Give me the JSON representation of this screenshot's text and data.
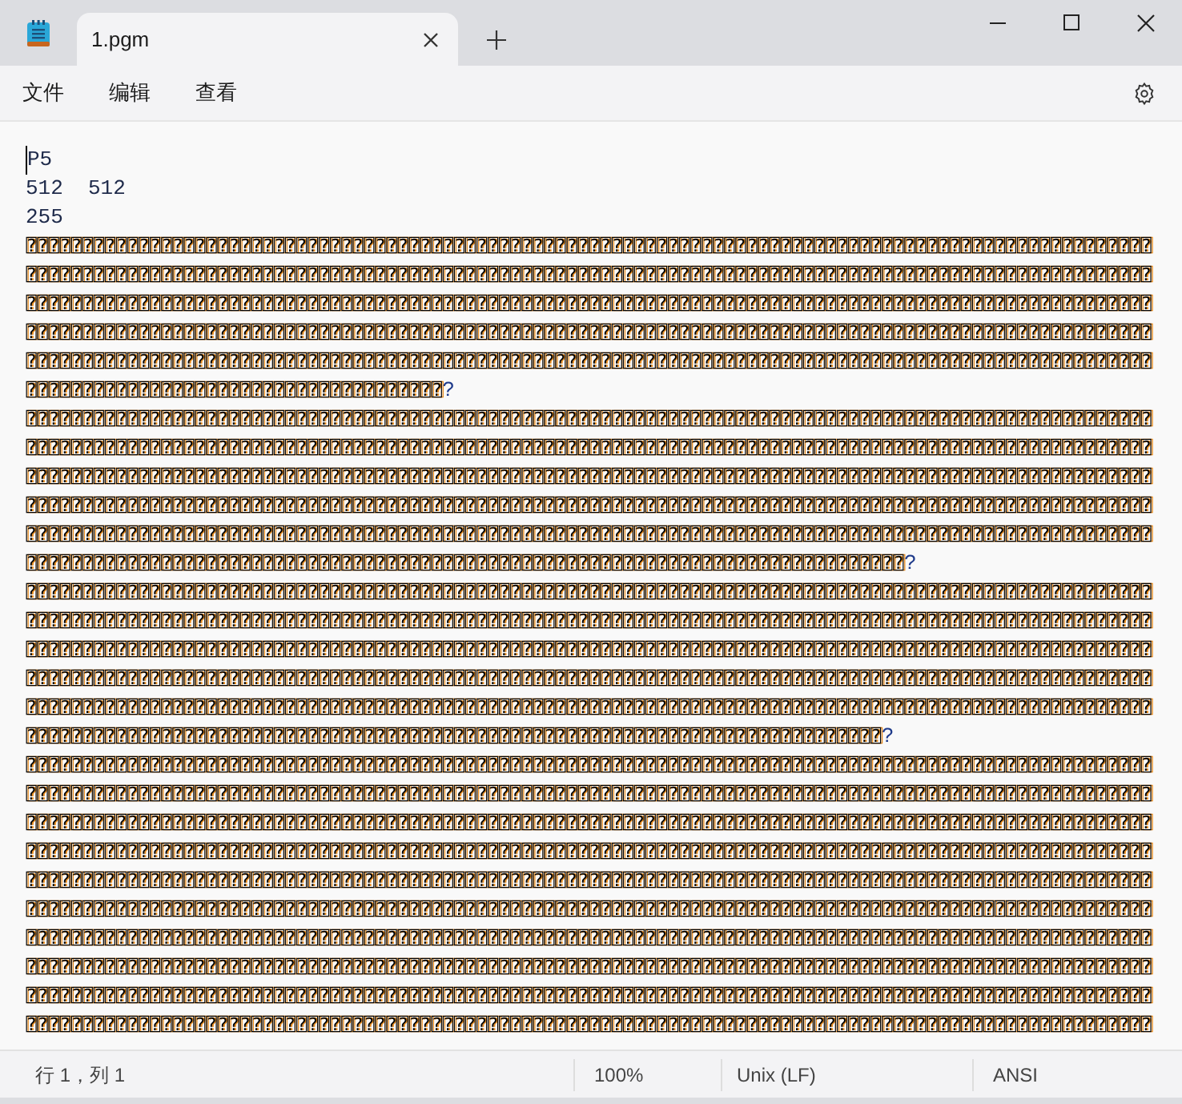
{
  "tabs": [
    {
      "label": "1.pgm",
      "selected": true
    }
  ],
  "menu": [
    "文件",
    "编辑",
    "查看"
  ],
  "editor": {
    "header_lines": [
      "P5",
      "512  512",
      "255"
    ],
    "binary_lines": [
      {
        "rows": [
          "⍰⍰⍰⍰⍰⍰⍰⍰⍰⍰⍰⍰⍰⍰⍰⍰⍰⍰⍰⍰⍰⍰⍰⍰⍰⍰⍰⍰⍰⍰⍰⍰⍰⍰⍰⍰⍰⍰⍰⍰⍰⍰⍰⍰⍰⍰⍰⍰⍰⍰⍰⍰⍰⍰⍰⍰⍰⍰⍰⍰⍰⍰⍰⍰⍰⍰⍰⍰⍰⍰⍰⍰⍰⍰⍰⍰⍰⍰⍰⍰⍰⍰⍰⍰⍰⍰⍰⍰⍰⍰⍰⍰⍰⍰⍰⍰⍰⍰⍰⍰",
          "⍰⍰⍰⍰⍰⍰⍰⍰⍰⍰⍰⍰⍰⍰⍰⍰⍰⍰⍰⍰⍰⍰⍰⍰⍰⍰⍰⍰⍰⍰⍰⍰⍰⍰⍰⍰⍰⍰⍰⍰⍰⍰⍰⍰⍰⍰⍰⍰⍰⍰⍰⍰⍰⍰⍰⍰⍰⍰⍰⍰⍰⍰⍰⍰⍰⍰⍰⍰⍰⍰⍰⍰⍰⍰⍰⍰⍰⍰⍰⍰⍰⍰⍰⍰⍰⍰⍰⍰⍰⍰⍰⍰⍰⍰⍰⍰⍰⍰⍰⍰",
          "⍰⍰⍰⍰⍰⍰⍰⍰⍰⍰⍰⍰⍰⍰⍰⍰⍰⍰⍰⍰⍰⍰⍰⍰⍰⍰⍰⍰⍰⍰⍰⍰⍰⍰⍰⍰⍰⍰⍰⍰⍰⍰⍰⍰⍰⍰⍰⍰⍰⍰⍰⍰⍰⍰⍰⍰⍰⍰⍰⍰⍰⍰⍰⍰⍰⍰⍰⍰⍰⍰⍰⍰⍰⍰⍰⍰⍰⍰⍰⍰⍰⍰⍰⍰⍰⍰⍰⍰⍰⍰⍰⍰⍰⍰⍰⍰⍰⍰⍰⍰",
          "⍰⍰⍰⍰⍰⍰⍰⍰⍰⍰⍰⍰⍰⍰⍰⍰⍰⍰⍰⍰⍰⍰⍰⍰⍰⍰⍰⍰⍰⍰⍰⍰⍰⍰⍰⍰⍰⍰⍰⍰⍰⍰⍰⍰⍰⍰⍰⍰⍰⍰⍰⍰⍰⍰⍰⍰⍰⍰⍰⍰⍰⍰⍰⍰⍰⍰⍰⍰⍰⍰⍰⍰⍰⍰⍰⍰⍰⍰⍰⍰⍰⍰⍰⍰⍰⍰⍰⍰⍰⍰⍰⍰⍰⍰⍰⍰⍰⍰⍰⍰",
          "⍰⍰⍰⍰⍰⍰⍰⍰⍰⍰⍰⍰⍰⍰⍰⍰⍰⍰⍰⍰⍰⍰⍰⍰⍰⍰⍰⍰⍰⍰⍰⍰⍰⍰⍰⍰⍰⍰⍰⍰⍰⍰⍰⍰⍰⍰⍰⍰⍰⍰⍰⍰⍰⍰⍰⍰⍰⍰⍰⍰⍰⍰⍰⍰⍰⍰⍰⍰⍰⍰⍰⍰⍰⍰⍰⍰⍰⍰⍰⍰⍰⍰⍰⍰⍰⍰⍰⍰⍰⍰⍰⍰⍰⍰⍰⍰⍰⍰⍰⍰",
          "⍰⍰⍰⍰⍰⍰⍰⍰⍰⍰⍰⍰⍰⍰⍰⍰⍰⍰⍰⍰⍰⍰⍰⍰⍰⍰⍰⍰⍰⍰⍰⍰⍰⍰⍰⍰⍰"
        ],
        "tail": "?"
      },
      {
        "rows": [
          "⍰⍰⍰⍰⍰⍰⍰⍰⍰⍰⍰⍰⍰⍰⍰⍰⍰⍰⍰⍰⍰⍰⍰⍰⍰⍰⍰⍰⍰⍰⍰⍰⍰⍰⍰⍰⍰⍰⍰⍰⍰⍰⍰⍰⍰⍰⍰⍰⍰⍰⍰⍰⍰⍰⍰⍰⍰⍰⍰⍰⍰⍰⍰⍰⍰⍰⍰⍰⍰⍰⍰⍰⍰⍰⍰⍰⍰⍰⍰⍰⍰⍰⍰⍰⍰⍰⍰⍰⍰⍰⍰⍰⍰⍰⍰⍰⍰⍰⍰⍰",
          "⍰⍰⍰⍰⍰⍰⍰⍰⍰⍰⍰⍰⍰⍰⍰⍰⍰⍰⍰⍰⍰⍰⍰⍰⍰⍰⍰⍰⍰⍰⍰⍰⍰⍰⍰⍰⍰⍰⍰⍰⍰⍰⍰⍰⍰⍰⍰⍰⍰⍰⍰⍰⍰⍰⍰⍰⍰⍰⍰⍰⍰⍰⍰⍰⍰⍰⍰⍰⍰⍰⍰⍰⍰⍰⍰⍰⍰⍰⍰⍰⍰⍰⍰⍰⍰⍰⍰⍰⍰⍰⍰⍰⍰⍰⍰⍰⍰⍰⍰⍰",
          "⍰⍰⍰⍰⍰⍰⍰⍰⍰⍰⍰⍰⍰⍰⍰⍰⍰⍰⍰⍰⍰⍰⍰⍰⍰⍰⍰⍰⍰⍰⍰⍰⍰⍰⍰⍰⍰⍰⍰⍰⍰⍰⍰⍰⍰⍰⍰⍰⍰⍰⍰⍰⍰⍰⍰⍰⍰⍰⍰⍰⍰⍰⍰⍰⍰⍰⍰⍰⍰⍰⍰⍰⍰⍰⍰⍰⍰⍰⍰⍰⍰⍰⍰⍰⍰⍰⍰⍰⍰⍰⍰⍰⍰⍰⍰⍰⍰⍰⍰⍰",
          "⍰⍰⍰⍰⍰⍰⍰⍰⍰⍰⍰⍰⍰⍰⍰⍰⍰⍰⍰⍰⍰⍰⍰⍰⍰⍰⍰⍰⍰⍰⍰⍰⍰⍰⍰⍰⍰⍰⍰⍰⍰⍰⍰⍰⍰⍰⍰⍰⍰⍰⍰⍰⍰⍰⍰⍰⍰⍰⍰⍰⍰⍰⍰⍰⍰⍰⍰⍰⍰⍰⍰⍰⍰⍰⍰⍰⍰⍰⍰⍰⍰⍰⍰⍰⍰⍰⍰⍰⍰⍰⍰⍰⍰⍰⍰⍰⍰⍰⍰⍰",
          "⍰⍰⍰⍰⍰⍰⍰⍰⍰⍰⍰⍰⍰⍰⍰⍰⍰⍰⍰⍰⍰⍰⍰⍰⍰⍰⍰⍰⍰⍰⍰⍰⍰⍰⍰⍰⍰⍰⍰⍰⍰⍰⍰⍰⍰⍰⍰⍰⍰⍰⍰⍰⍰⍰⍰⍰⍰⍰⍰⍰⍰⍰⍰⍰⍰⍰⍰⍰⍰⍰⍰⍰⍰⍰⍰⍰⍰⍰⍰⍰⍰⍰⍰⍰⍰⍰⍰⍰⍰⍰⍰⍰⍰⍰⍰⍰⍰⍰⍰⍰",
          "⍰⍰⍰⍰⍰⍰⍰⍰⍰⍰⍰⍰⍰⍰⍰⍰⍰⍰⍰⍰⍰⍰⍰⍰⍰⍰⍰⍰⍰⍰⍰⍰⍰⍰⍰⍰⍰⍰⍰⍰⍰⍰⍰⍰⍰⍰⍰⍰⍰⍰⍰⍰⍰⍰⍰⍰⍰⍰⍰⍰⍰⍰⍰⍰⍰⍰⍰⍰⍰⍰⍰⍰⍰⍰⍰⍰⍰⍰"
        ],
        "tail": "?"
      },
      {
        "rows": [
          "⍰⍰⍰⍰⍰⍰⍰⍰⍰⍰⍰⍰⍰⍰⍰⍰⍰⍰⍰⍰⍰⍰⍰⍰⍰⍰⍰⍰⍰⍰⍰⍰⍰⍰⍰⍰⍰⍰⍰⍰⍰⍰⍰⍰⍰⍰⍰⍰⍰⍰⍰⍰⍰⍰⍰⍰⍰⍰⍰⍰⍰⍰⍰⍰⍰⍰⍰⍰⍰⍰⍰⍰⍰⍰⍰⍰⍰⍰⍰⍰⍰⍰⍰⍰⍰⍰⍰⍰⍰⍰⍰⍰⍰⍰⍰⍰⍰⍰⍰⍰",
          "⍰⍰⍰⍰⍰⍰⍰⍰⍰⍰⍰⍰⍰⍰⍰⍰⍰⍰⍰⍰⍰⍰⍰⍰⍰⍰⍰⍰⍰⍰⍰⍰⍰⍰⍰⍰⍰⍰⍰⍰⍰⍰⍰⍰⍰⍰⍰⍰⍰⍰⍰⍰⍰⍰⍰⍰⍰⍰⍰⍰⍰⍰⍰⍰⍰⍰⍰⍰⍰⍰⍰⍰⍰⍰⍰⍰⍰⍰⍰⍰⍰⍰⍰⍰⍰⍰⍰⍰⍰⍰⍰⍰⍰⍰⍰⍰⍰⍰⍰⍰",
          "⍰⍰⍰⍰⍰⍰⍰⍰⍰⍰⍰⍰⍰⍰⍰⍰⍰⍰⍰⍰⍰⍰⍰⍰⍰⍰⍰⍰⍰⍰⍰⍰⍰⍰⍰⍰⍰⍰⍰⍰⍰⍰⍰⍰⍰⍰⍰⍰⍰⍰⍰⍰⍰⍰⍰⍰⍰⍰⍰⍰⍰⍰⍰⍰⍰⍰⍰⍰⍰⍰⍰⍰⍰⍰⍰⍰⍰⍰⍰⍰⍰⍰⍰⍰⍰⍰⍰⍰⍰⍰⍰⍰⍰⍰⍰⍰⍰⍰⍰⍰",
          "⍰⍰⍰⍰⍰⍰⍰⍰⍰⍰⍰⍰⍰⍰⍰⍰⍰⍰⍰⍰⍰⍰⍰⍰⍰⍰⍰⍰⍰⍰⍰⍰⍰⍰⍰⍰⍰⍰⍰⍰⍰⍰⍰⍰⍰⍰⍰⍰⍰⍰⍰⍰⍰⍰⍰⍰⍰⍰⍰⍰⍰⍰⍰⍰⍰⍰⍰⍰⍰⍰⍰⍰⍰⍰⍰⍰⍰⍰⍰⍰⍰⍰⍰⍰⍰⍰⍰⍰⍰⍰⍰⍰⍰⍰⍰⍰⍰⍰⍰⍰",
          "⍰⍰⍰⍰⍰⍰⍰⍰⍰⍰⍰⍰⍰⍰⍰⍰⍰⍰⍰⍰⍰⍰⍰⍰⍰⍰⍰⍰⍰⍰⍰⍰⍰⍰⍰⍰⍰⍰⍰⍰⍰⍰⍰⍰⍰⍰⍰⍰⍰⍰⍰⍰⍰⍰⍰⍰⍰⍰⍰⍰⍰⍰⍰⍰⍰⍰⍰⍰⍰⍰⍰⍰⍰⍰⍰⍰⍰⍰⍰⍰⍰⍰⍰⍰⍰⍰⍰⍰⍰⍰⍰⍰⍰⍰⍰⍰⍰⍰⍰⍰",
          "⍰⍰⍰⍰⍰⍰⍰⍰⍰⍰⍰⍰⍰⍰⍰⍰⍰⍰⍰⍰⍰⍰⍰⍰⍰⍰⍰⍰⍰⍰⍰⍰⍰⍰⍰⍰⍰⍰⍰⍰⍰⍰⍰⍰⍰⍰⍰⍰⍰⍰⍰⍰⍰⍰⍰⍰⍰⍰⍰⍰⍰⍰⍰⍰⍰⍰⍰⍰⍰⍰⍰⍰⍰⍰⍰⍰"
        ],
        "tail": "?"
      },
      {
        "rows": [
          "⍰⍰⍰⍰⍰⍰⍰⍰⍰⍰⍰⍰⍰⍰⍰⍰⍰⍰⍰⍰⍰⍰⍰⍰⍰⍰⍰⍰⍰⍰⍰⍰⍰⍰⍰⍰⍰⍰⍰⍰⍰⍰⍰⍰⍰⍰⍰⍰⍰⍰⍰⍰⍰⍰⍰⍰⍰⍰⍰⍰⍰⍰⍰⍰⍰⍰⍰⍰⍰⍰⍰⍰⍰⍰⍰⍰⍰⍰⍰⍰⍰⍰⍰⍰⍰⍰⍰⍰⍰⍰⍰⍰⍰⍰⍰⍰⍰⍰⍰⍰",
          "⍰⍰⍰⍰⍰⍰⍰⍰⍰⍰⍰⍰⍰⍰⍰⍰⍰⍰⍰⍰⍰⍰⍰⍰⍰⍰⍰⍰⍰⍰⍰⍰⍰⍰⍰⍰⍰⍰⍰⍰⍰⍰⍰⍰⍰⍰⍰⍰⍰⍰⍰⍰⍰⍰⍰⍰⍰⍰⍰⍰⍰⍰⍰⍰⍰⍰⍰⍰⍰⍰⍰⍰⍰⍰⍰⍰⍰⍰⍰⍰⍰⍰⍰⍰⍰⍰⍰⍰⍰⍰⍰⍰⍰⍰⍰⍰⍰⍰⍰⍰",
          "⍰⍰⍰⍰⍰⍰⍰⍰⍰⍰⍰⍰⍰⍰⍰⍰⍰⍰⍰⍰⍰⍰⍰⍰⍰⍰⍰⍰⍰⍰⍰⍰⍰⍰⍰⍰⍰⍰⍰⍰⍰⍰⍰⍰⍰⍰⍰⍰⍰⍰⍰⍰⍰⍰⍰⍰⍰⍰⍰⍰⍰⍰⍰⍰⍰⍰⍰⍰⍰⍰⍰⍰⍰⍰⍰⍰⍰⍰⍰⍰⍰⍰⍰⍰⍰⍰⍰⍰⍰⍰⍰⍰⍰⍰⍰⍰⍰⍰⍰⍰",
          "⍰⍰⍰⍰⍰⍰⍰⍰⍰⍰⍰⍰⍰⍰⍰⍰⍰⍰⍰⍰⍰⍰⍰⍰⍰⍰⍰⍰⍰⍰⍰⍰⍰⍰⍰⍰⍰⍰⍰⍰⍰⍰⍰⍰⍰⍰⍰⍰⍰⍰⍰⍰⍰⍰⍰⍰⍰⍰⍰⍰⍰⍰⍰⍰⍰⍰⍰⍰⍰⍰⍰⍰⍰⍰⍰⍰⍰⍰⍰⍰⍰⍰⍰⍰⍰⍰⍰⍰⍰⍰⍰⍰⍰⍰⍰⍰⍰⍰⍰⍰",
          "⍰⍰⍰⍰⍰⍰⍰⍰⍰⍰⍰⍰⍰⍰⍰⍰⍰⍰⍰⍰⍰⍰⍰⍰⍰⍰⍰⍰⍰⍰⍰⍰⍰⍰⍰⍰⍰⍰⍰⍰⍰⍰⍰⍰⍰⍰⍰⍰⍰⍰⍰⍰⍰⍰⍰⍰⍰⍰⍰⍰⍰⍰⍰⍰⍰⍰⍰⍰⍰⍰⍰⍰⍰⍰⍰⍰⍰⍰⍰⍰⍰⍰⍰⍰⍰⍰⍰⍰⍰⍰⍰⍰⍰⍰⍰⍰⍰⍰⍰⍰",
          "⍰⍰⍰⍰⍰⍰⍰⍰⍰⍰⍰⍰⍰⍰⍰⍰⍰⍰⍰⍰⍰⍰⍰⍰⍰⍰⍰⍰⍰⍰⍰⍰⍰⍰⍰⍰⍰⍰⍰⍰⍰⍰⍰⍰⍰⍰⍰⍰⍰⍰⍰⍰⍰⍰⍰⍰⍰⍰⍰⍰⍰⍰⍰⍰⍰⍰⍰⍰⍰⍰⍰⍰⍰⍰⍰⍰⍰⍰⍰⍰⍰⍰⍰⍰⍰⍰⍰⍰⍰⍰⍰⍰⍰⍰⍰⍰⍰⍰⍰⍰",
          "⍰⍰⍰⍰⍰⍰⍰⍰⍰⍰⍰⍰⍰⍰⍰⍰⍰⍰⍰⍰⍰⍰⍰⍰⍰⍰⍰⍰⍰⍰⍰⍰⍰⍰⍰⍰⍰⍰⍰⍰⍰⍰⍰⍰⍰⍰⍰⍰⍰⍰⍰⍰⍰⍰⍰⍰⍰⍰⍰⍰⍰⍰⍰⍰⍰⍰⍰⍰⍰⍰⍰⍰⍰⍰⍰⍰⍰⍰⍰⍰⍰⍰⍰⍰⍰⍰⍰⍰⍰⍰⍰⍰⍰⍰⍰⍰⍰⍰⍰⍰",
          "⍰⍰⍰⍰⍰⍰⍰⍰⍰⍰⍰⍰⍰⍰⍰⍰⍰⍰⍰⍰⍰⍰⍰⍰⍰⍰⍰⍰⍰⍰⍰⍰⍰⍰⍰⍰⍰⍰⍰⍰⍰⍰⍰⍰⍰⍰⍰⍰⍰⍰⍰⍰⍰⍰⍰⍰⍰⍰⍰⍰⍰⍰⍰⍰⍰⍰⍰⍰⍰⍰⍰⍰⍰⍰⍰⍰⍰⍰⍰⍰⍰⍰⍰⍰⍰⍰⍰⍰⍰⍰⍰⍰⍰⍰⍰⍰⍰⍰⍰⍰",
          "⍰⍰⍰⍰⍰⍰⍰⍰⍰⍰⍰⍰⍰⍰⍰⍰⍰⍰⍰⍰⍰⍰⍰⍰⍰⍰⍰⍰⍰⍰⍰⍰⍰⍰⍰⍰⍰⍰⍰⍰⍰⍰⍰⍰⍰⍰⍰⍰⍰⍰⍰⍰⍰⍰⍰⍰⍰⍰⍰⍰⍰⍰⍰⍰⍰⍰⍰⍰⍰⍰⍰⍰⍰⍰⍰⍰⍰⍰⍰⍰⍰⍰⍰⍰⍰⍰⍰⍰⍰⍰⍰⍰⍰⍰⍰⍰⍰⍰⍰⍰",
          "⍰⍰⍰⍰⍰⍰⍰⍰⍰⍰⍰⍰⍰⍰⍰⍰⍰⍰⍰⍰⍰⍰⍰⍰⍰⍰⍰⍰⍰⍰⍰⍰⍰⍰⍰⍰⍰⍰⍰⍰⍰⍰⍰⍰⍰⍰⍰⍰⍰⍰⍰⍰⍰⍰⍰⍰⍰⍰⍰⍰⍰⍰⍰⍰⍰⍰⍰⍰⍰⍰⍰⍰⍰⍰⍰⍰⍰⍰⍰⍰⍰⍰⍰⍰⍰⍰⍰⍰⍰⍰⍰⍰⍰⍰⍰⍰⍰⍰⍰⍰"
        ]
      }
    ]
  },
  "status_bar": [
    "行 1，列 1",
    "100%",
    "Unix (LF)",
    "ANSI"
  ]
}
